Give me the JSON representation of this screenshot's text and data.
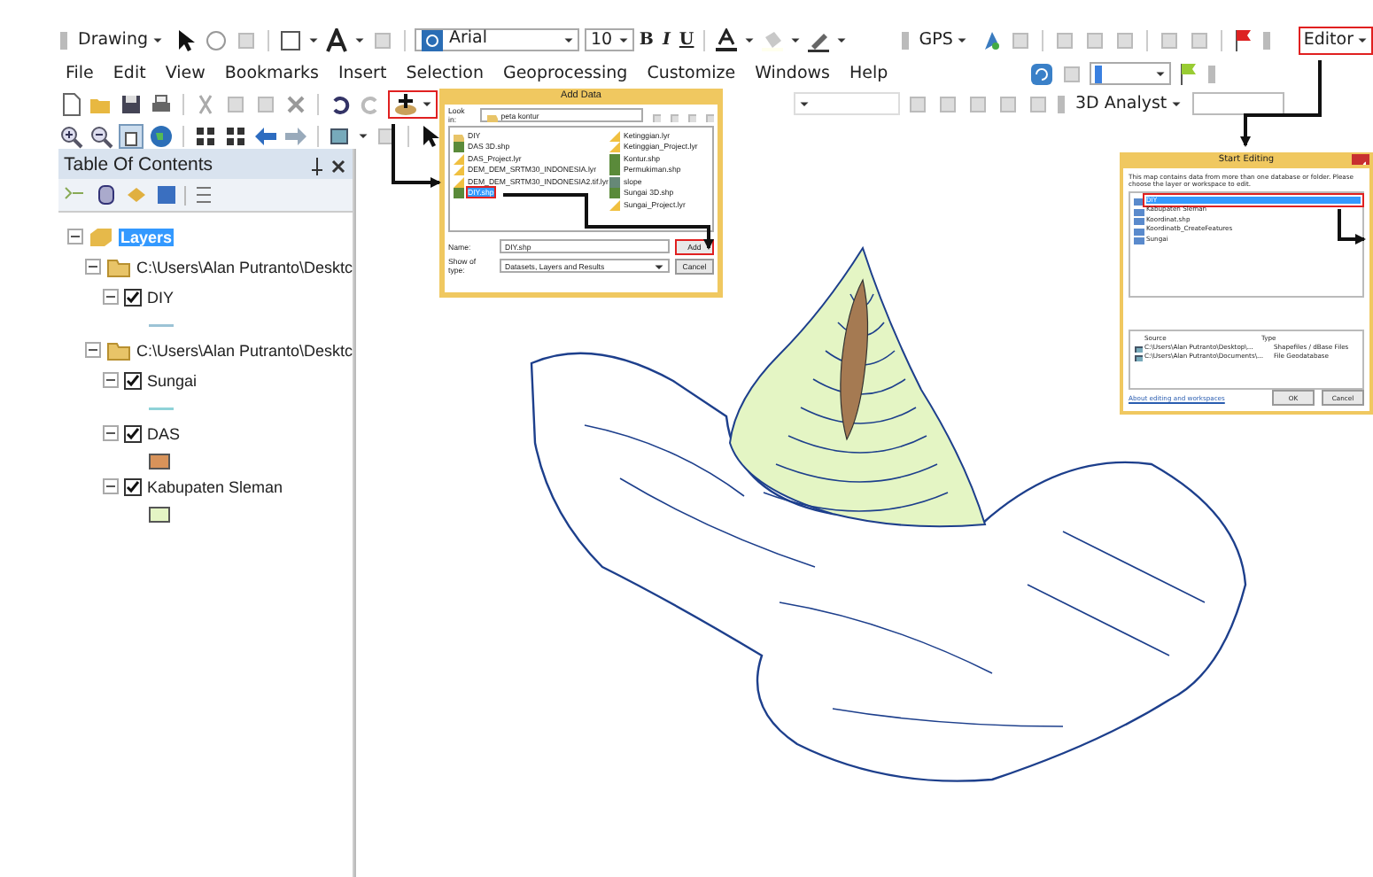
{
  "drawing_toolbar": {
    "menu": "Drawing",
    "font": "Arial",
    "font_size": "10",
    "bold": "B",
    "italic": "I",
    "underline": "U"
  },
  "gps_toolbar": {
    "menu": "GPS"
  },
  "editor_toolbar": {
    "menu": "Editor",
    "highlighted": true
  },
  "menu_bar": [
    "File",
    "Edit",
    "View",
    "Bookmarks",
    "Insert",
    "Selection",
    "Geoprocessing",
    "Customize",
    "Windows",
    "Help"
  ],
  "standard_toolbar": {
    "add_data_highlighted": true
  },
  "analyst_toolbar": {
    "menu": "3D Analyst"
  },
  "toc": {
    "title": "Table Of Contents",
    "layers": {
      "label": "Layers",
      "kind": "frame",
      "selected": true,
      "expanded": true,
      "children": [
        {
          "label": "C:\\Users\\Alan Putranto\\Desktc",
          "kind": "folder",
          "expanded": true,
          "children": [
            {
              "label": "DIY",
              "kind": "line",
              "expanded": true,
              "checked": true,
              "color": "#9cc3d6"
            }
          ]
        },
        {
          "label": "C:\\Users\\Alan Putranto\\Desktc",
          "kind": "folder",
          "expanded": true,
          "children": [
            {
              "label": "Sungai",
              "kind": "line",
              "expanded": true,
              "checked": true,
              "color": "#8fd3d8"
            },
            {
              "label": "DAS",
              "kind": "fill",
              "expanded": true,
              "checked": true,
              "color": "#d8935a"
            },
            {
              "label": "Kabupaten Sleman",
              "kind": "fill",
              "expanded": true,
              "checked": true,
              "color": "#e4f5c4"
            }
          ]
        }
      ]
    }
  },
  "add_data_dialog": {
    "title": "Add Data",
    "look_in_label": "Look in:",
    "look_in": "peta kontur",
    "files": [
      {
        "name": "DIY",
        "kind": "folder",
        "selected": false
      },
      {
        "name": "DAS 3D.shp",
        "kind": "shp",
        "selected": false
      },
      {
        "name": "DAS_Project.lyr",
        "kind": "lyr",
        "selected": false
      },
      {
        "name": "DEM_DEM_SRTM30_INDONESIA.lyr",
        "kind": "lyr",
        "selected": false
      },
      {
        "name": "DEM_DEM_SRTM30_INDONESIA2.tif.lyr",
        "kind": "lyr",
        "selected": false
      },
      {
        "name": "DIY.shp",
        "kind": "shp",
        "selected": true
      },
      {
        "name": "Ketinggian.lyr",
        "kind": "lyr",
        "selected": false
      },
      {
        "name": "Ketinggian_Project.lyr",
        "kind": "lyr",
        "selected": false
      },
      {
        "name": "Kontur.shp",
        "kind": "shp",
        "selected": false
      },
      {
        "name": "Permukiman.shp",
        "kind": "shp",
        "selected": false
      },
      {
        "name": "slope",
        "kind": "raster",
        "selected": false
      },
      {
        "name": "Sungai 3D.shp",
        "kind": "shp",
        "selected": false
      },
      {
        "name": "Sungai_Project.lyr",
        "kind": "lyr",
        "selected": false
      }
    ],
    "name_label": "Name:",
    "name": "DIY.shp",
    "type_label": "Show of type:",
    "type": "Datasets, Layers and Results",
    "buttons": [
      {
        "label": "Add",
        "highlighted": true
      },
      {
        "label": "Cancel",
        "highlighted": false
      }
    ]
  },
  "start_editing_dialog": {
    "title": "Start Editing",
    "message": "This map contains data from more than one database or folder. Please choose the layer or workspace to edit.",
    "layers": [
      {
        "name": "DIY",
        "selected": true
      },
      {
        "name": "Kabupaten Sleman",
        "selected": false
      },
      {
        "name": "Koordinat.shp",
        "selected": false
      },
      {
        "name": "Koordinatb_CreateFeatures",
        "selected": false
      },
      {
        "name": "Sungai",
        "selected": false
      }
    ],
    "columns": [
      "Source",
      "Type"
    ],
    "rows": [
      [
        "C:\\Users\\Alan Putranto\\Desktop\\...",
        "Shapefiles / dBase Files"
      ],
      [
        "C:\\Users\\Alan Putranto\\Documents\\...",
        "File Geodatabase"
      ]
    ],
    "link": "About editing and workspaces",
    "buttons": [
      "OK",
      "Cancel"
    ]
  }
}
